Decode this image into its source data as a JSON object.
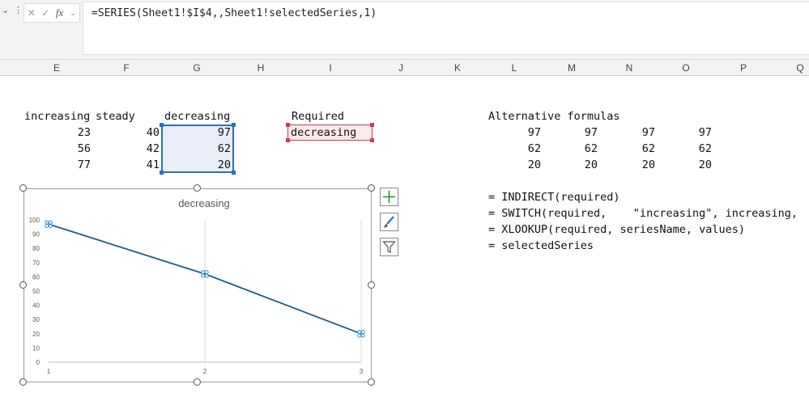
{
  "formula_bar": {
    "formula": "=SERIES(Sheet1!$I$4,,Sheet1!selectedSeries,1)",
    "fx_label": "fx"
  },
  "columns": [
    "E",
    "F",
    "G",
    "H",
    "I",
    "J",
    "K",
    "L",
    "M",
    "N",
    "O",
    "P",
    "Q"
  ],
  "sheet": {
    "headers": {
      "increasing": "increasing",
      "steady": "steady",
      "decreasing": "decreasing",
      "required": "Required",
      "alternative": "Alternative formulas"
    },
    "increasing": [
      "23",
      "56",
      "77"
    ],
    "steady": [
      "40",
      "42",
      "41"
    ],
    "decreasing": [
      "97",
      "62",
      "20"
    ],
    "required_value": "decreasing",
    "alternative_values": [
      [
        "97",
        "97",
        "97",
        "97"
      ],
      [
        "62",
        "62",
        "62",
        "62"
      ],
      [
        "20",
        "20",
        "20",
        "20"
      ]
    ],
    "formulas": [
      "= INDIRECT(required)",
      "= SWITCH(required,    \"increasing\", increasing,",
      "= XLOOKUP(required, seriesName, values)",
      "= selectedSeries"
    ]
  },
  "chart_data": {
    "type": "line",
    "title": "decreasing",
    "categories": [
      "1",
      "2",
      "3"
    ],
    "values": [
      97,
      62,
      20
    ],
    "ylim": [
      0,
      100
    ],
    "yticks": [
      "0",
      "10",
      "20",
      "30",
      "40",
      "50",
      "60",
      "70",
      "80",
      "90",
      "100"
    ],
    "line_color": "#1f5c87",
    "grid": "vertical"
  },
  "colors": {
    "selection": "#2f6ec4",
    "required_border": "#c4414e",
    "plus_icon": "#2e8b3a",
    "brush_icon": "#2f6ec4"
  }
}
